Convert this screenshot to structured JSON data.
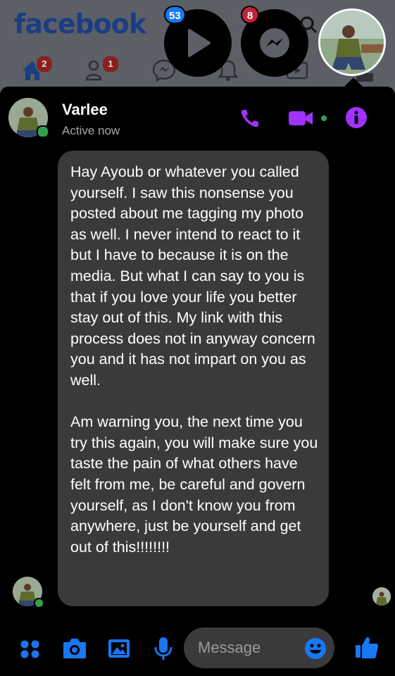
{
  "facebook": {
    "logo": "facebook",
    "nav": {
      "home_badge": "2",
      "friends_badge": "1"
    }
  },
  "floating": {
    "watch_badge": "53",
    "messenger_badge": "8"
  },
  "chat": {
    "contact_name": "Varlee",
    "contact_status": "Active now",
    "message": "Hay Ayoub or whatever you called yourself. I saw this nonsense you posted about me tagging my photo as well. I never intend to react to it but I have to because it is on the media. But what I can say to you is that if you love your life you better stay out of this. My link with this process does not in anyway concern you and it has not impart on you as well.\n\nAm warning you, the next time you try this again, you will make sure you taste the pain of what others have felt from me, be careful and govern yourself, as I don't know you from anywhere, just be yourself and get out of this!!!!!!!!",
    "composer_placeholder": "Message"
  },
  "icons": {
    "header": [
      "phone-icon",
      "video-call-icon",
      "info-icon"
    ],
    "composer": [
      "menu-dots-icon",
      "camera-icon",
      "gallery-icon",
      "microphone-icon",
      "emoji-icon",
      "like-icon"
    ]
  },
  "colors": {
    "accent_purple": "#a033ff",
    "messenger_blue": "#1877f2",
    "online_green": "#31a24c",
    "bubble_gray": "#3a3a3c",
    "badge_red": "#e41e3f",
    "badge_blue": "#1877f2"
  }
}
